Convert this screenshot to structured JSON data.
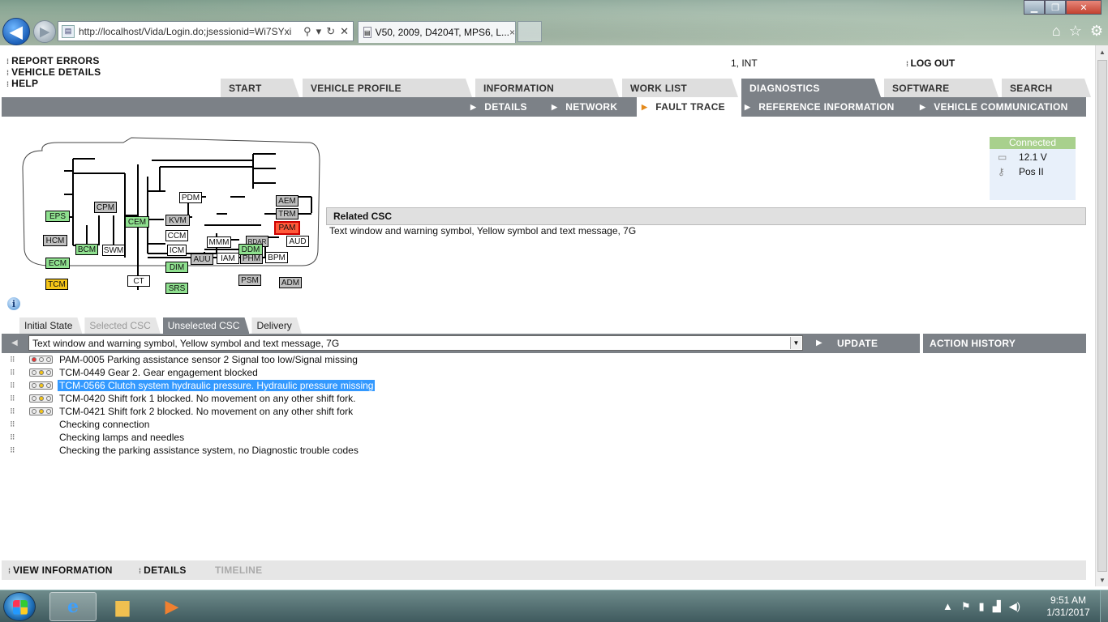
{
  "browser": {
    "url": "http://localhost/Vida/Login.do;jsessionid=Wi7SYxi",
    "url_host": "localhost",
    "tab_title": "V50, 2009, D4204T, MPS6, L...",
    "tab_close": "×",
    "back_glyph": "◀",
    "fwd_glyph": "▶"
  },
  "left_links": [
    "REPORT ERRORS",
    "VEHICLE DETAILS",
    "HELP"
  ],
  "user_info": "1, INT",
  "logout_label": "LOG OUT",
  "main_tabs": [
    {
      "label": "START",
      "active": false
    },
    {
      "label": "VEHICLE PROFILE",
      "active": false
    },
    {
      "label": "INFORMATION",
      "active": false
    },
    {
      "label": "WORK LIST",
      "active": false
    },
    {
      "label": "DIAGNOSTICS",
      "active": true
    },
    {
      "label": "SOFTWARE",
      "active": false
    },
    {
      "label": "SEARCH",
      "active": false
    }
  ],
  "sub_tabs": [
    {
      "label": "DETAILS",
      "active": false
    },
    {
      "label": "NETWORK",
      "active": false
    },
    {
      "label": "FAULT TRACE",
      "active": true
    },
    {
      "label": "REFERENCE INFORMATION",
      "active": false
    },
    {
      "label": "VEHICLE COMMUNICATION",
      "active": false
    }
  ],
  "network_nodes": [
    {
      "label": "EPS",
      "status": "green"
    },
    {
      "label": "CPM",
      "status": "gray"
    },
    {
      "label": "PDM",
      "status": "white"
    },
    {
      "label": "AEM",
      "status": "gray"
    },
    {
      "label": "TRM",
      "status": "gray"
    },
    {
      "label": "PAM",
      "status": "red"
    },
    {
      "label": "CEM",
      "status": "green"
    },
    {
      "label": "KVM",
      "status": "gray"
    },
    {
      "label": "HCM",
      "status": "gray"
    },
    {
      "label": "CCM",
      "status": "white"
    },
    {
      "label": "MMM",
      "status": "white"
    },
    {
      "label": "RDAR",
      "status": "gray"
    },
    {
      "label": "AUD",
      "status": "white"
    },
    {
      "label": "ICM",
      "status": "white"
    },
    {
      "label": "ECM",
      "status": "green"
    },
    {
      "label": "AUU",
      "status": "gray"
    },
    {
      "label": "IAM",
      "status": "white"
    },
    {
      "label": "PHM",
      "status": "gray"
    },
    {
      "label": "BPM",
      "status": "white"
    },
    {
      "label": "DIM",
      "status": "green"
    },
    {
      "label": "TCM",
      "status": "yellow"
    },
    {
      "label": "PSM",
      "status": "gray"
    },
    {
      "label": "ADM",
      "status": "gray"
    },
    {
      "label": "SRS",
      "status": "green"
    },
    {
      "label": "BCM",
      "status": "green"
    },
    {
      "label": "SWM",
      "status": "white"
    },
    {
      "label": "DDM",
      "status": "green"
    },
    {
      "label": "CT",
      "status": "white"
    }
  ],
  "status_colors": {
    "green": "#8fe08f",
    "gray": "#c0c0c0",
    "white": "#ffffff",
    "red": "#ff5a3a",
    "yellow": "#f5c518"
  },
  "info_icon_glyph": "i",
  "connection": {
    "status": "Connected",
    "voltage": "12.1 V",
    "ignition": "Pos II",
    "battery_icon": "battery-icon",
    "key_icon": "key-icon"
  },
  "related_csc": {
    "title": "Related CSC",
    "text": "Text window and warning symbol, Yellow symbol and text message, 7G"
  },
  "csc_tabs": [
    {
      "label": "Initial State",
      "state": "normal"
    },
    {
      "label": "Selected CSC",
      "state": "disabled"
    },
    {
      "label": "Unselected CSC",
      "state": "active"
    },
    {
      "label": "Delivery",
      "state": "normal"
    }
  ],
  "filter": {
    "selected": "Text window and warning symbol, Yellow symbol and text message, 7G",
    "update_label": "UPDATE",
    "history_label": "ACTION HISTORY"
  },
  "csc_items": [
    {
      "text": "PAM-0005 Parking assistance sensor 2 Signal too low/Signal missing",
      "lamp": "red",
      "selected": false
    },
    {
      "text": "TCM-0449 Gear 2. Gear engagement blocked",
      "lamp": "yellow",
      "selected": false
    },
    {
      "text": "TCM-0566 Clutch system hydraulic pressure. Hydraulic pressure missing",
      "lamp": "yellow",
      "selected": true
    },
    {
      "text": "TCM-0420 Shift fork 1 blocked. No movement on any other shift fork.",
      "lamp": "yellow",
      "selected": false
    },
    {
      "text": "TCM-0421 Shift fork 2 blocked. No movement on any other shift fork",
      "lamp": "yellow",
      "selected": false
    },
    {
      "text": "Checking connection",
      "lamp": "none",
      "selected": false
    },
    {
      "text": "Checking lamps and needles",
      "lamp": "none",
      "selected": false
    },
    {
      "text": "Checking the parking assistance system, no Diagnostic trouble codes",
      "lamp": "none",
      "selected": false
    }
  ],
  "bottom_actions": [
    {
      "label": "VIEW INFORMATION",
      "enabled": true
    },
    {
      "label": "DETAILS",
      "enabled": true
    },
    {
      "label": "TIMELINE",
      "enabled": false
    }
  ],
  "taskbar": {
    "time": "9:51 AM",
    "date": "1/31/2017"
  }
}
